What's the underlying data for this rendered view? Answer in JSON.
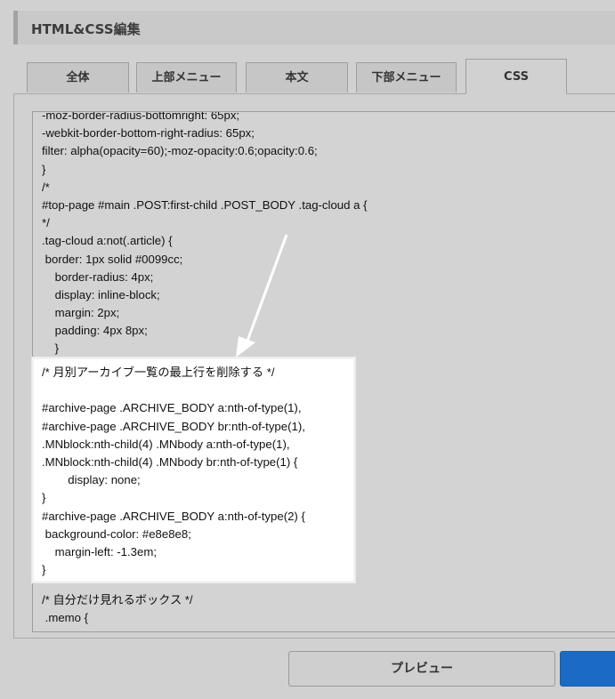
{
  "header": {
    "title": "HTML&CSS編集"
  },
  "tabs": [
    {
      "label": "全体",
      "active": false
    },
    {
      "label": "上部メニュー",
      "active": false
    },
    {
      "label": "本文",
      "active": false
    },
    {
      "label": "下部メニュー",
      "active": false
    },
    {
      "label": "CSS",
      "active": true
    }
  ],
  "editor": {
    "lines": [
      "-moz-border-radius-bottomright: 65px;",
      "-webkit-border-bottom-right-radius: 65px;",
      "filter: alpha(opacity=60);-moz-opacity:0.6;opacity:0.6;",
      "}",
      "/*",
      "#top-page #main .POST:first-child .POST_BODY .tag-cloud a {",
      "*/",
      ".tag-cloud a:not(.article) {",
      " border: 1px solid #0099cc;",
      "    border-radius: 4px;",
      "    display: inline-block;",
      "    margin: 2px;",
      "    padding: 4px 8px;",
      "    }",
      "",
      "",
      "",
      "",
      "",
      "",
      "",
      "",
      "",
      "",
      "",
      "",
      "",
      "/* 自分だけ見れるボックス */",
      " .memo {"
    ]
  },
  "highlight": {
    "lines": [
      "/* 月別アーカイブ一覧の最上行を削除する */",
      "",
      "#archive-page .ARCHIVE_BODY a:nth-of-type(1),",
      "#archive-page .ARCHIVE_BODY br:nth-of-type(1),",
      ".MNblock:nth-child(4) .MNbody a:nth-of-type(1),",
      ".MNblock:nth-child(4) .MNbody br:nth-of-type(1) {",
      "        display: none;",
      "}",
      "#archive-page .ARCHIVE_BODY a:nth-of-type(2) {",
      " background-color: #e8e8e8;",
      "    margin-left: -1.3em;",
      "}"
    ]
  },
  "buttons": {
    "preview": "プレビュー"
  },
  "colors": {
    "primary": "#1b6bc4",
    "arrow": "#ffffff"
  }
}
